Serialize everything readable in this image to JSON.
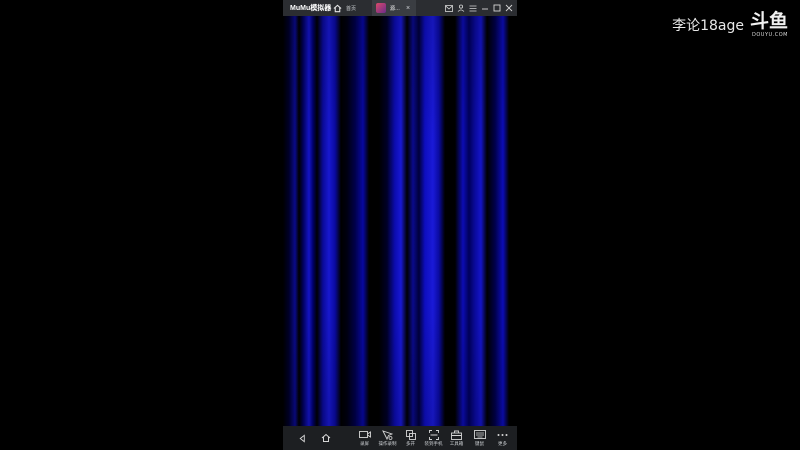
{
  "window": {
    "app_title": "MuMu模拟器",
    "home_tab_label": "首页",
    "game_tab_label": "源…",
    "close_glyph": "×"
  },
  "toolbar": {
    "tools": [
      {
        "label": "录屏",
        "icon": "video-record-icon"
      },
      {
        "label": "操作录制",
        "icon": "macro-record-icon"
      },
      {
        "label": "多开",
        "icon": "multi-instance-icon"
      },
      {
        "label": "装到手机",
        "icon": "install-to-phone-icon"
      },
      {
        "label": "工具箱",
        "icon": "toolbox-icon"
      },
      {
        "label": "键鼠",
        "icon": "keyboard-mouse-icon"
      },
      {
        "label": "更多",
        "icon": "more-icon"
      }
    ]
  },
  "watermark": {
    "streamer_name": "李论18age",
    "logo_text": "斗鱼",
    "logo_subtext": "DOUYU.COM"
  },
  "colors": {
    "titlebar_bg": "#2b2d31",
    "stripe_blue": "#1818d0",
    "background": "#000000"
  }
}
